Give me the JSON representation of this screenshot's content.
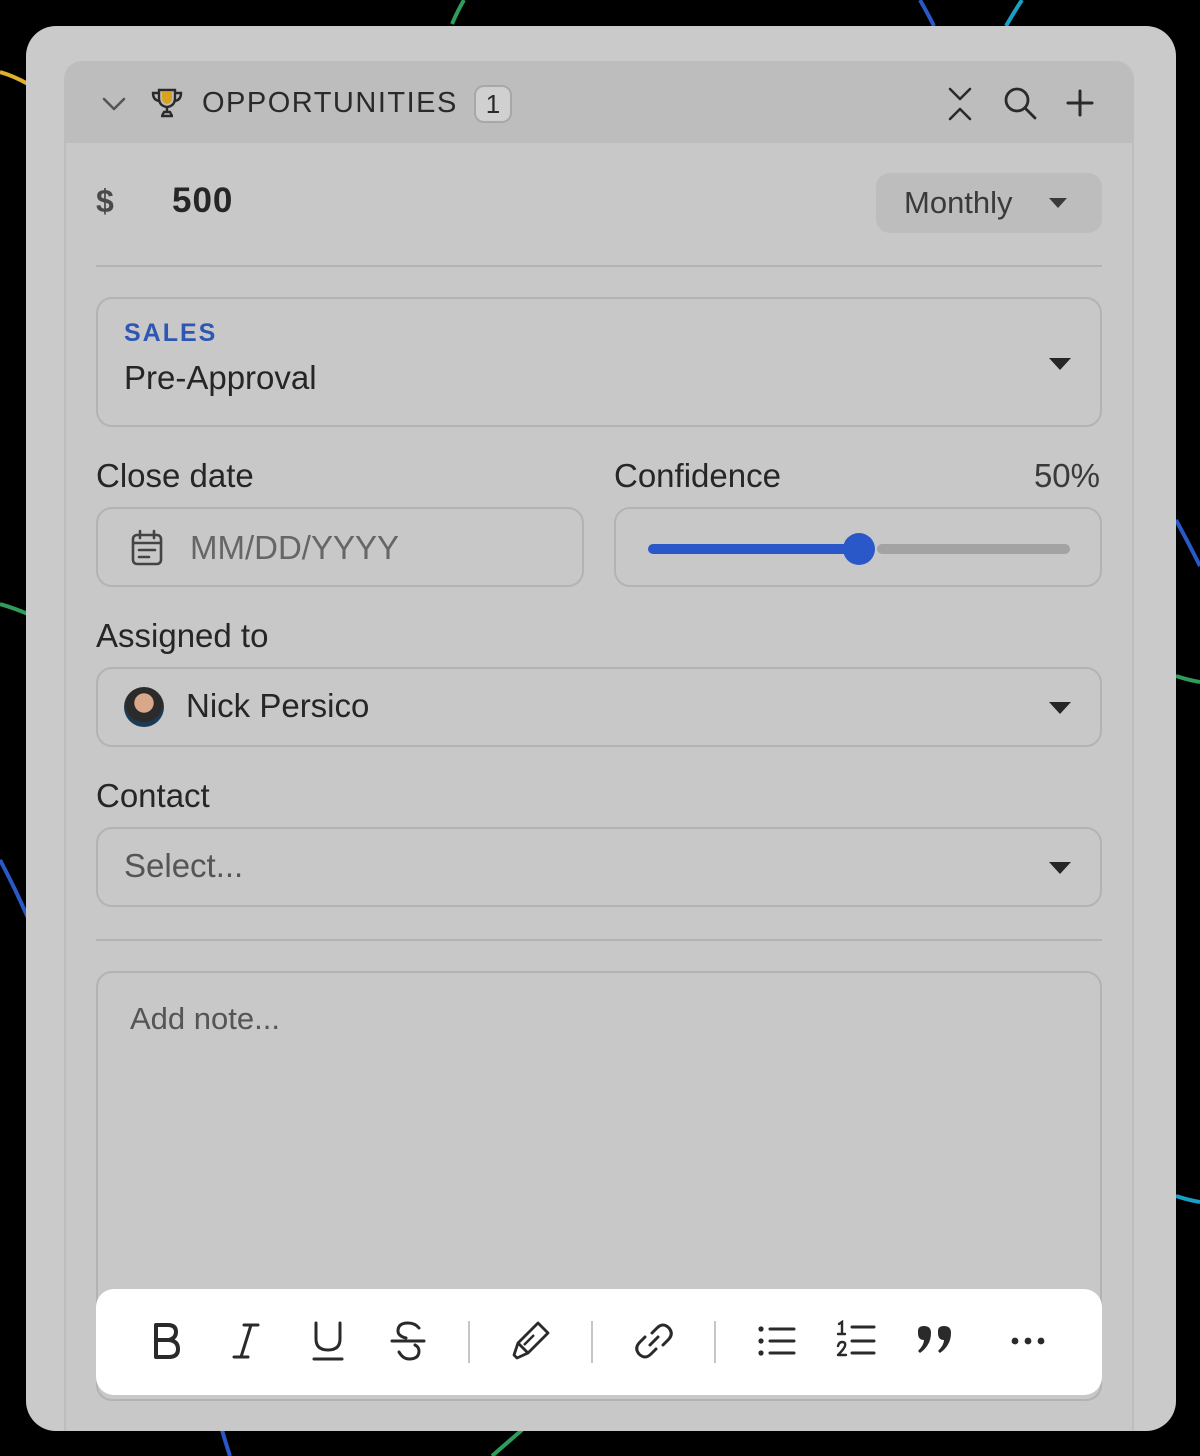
{
  "colors": {
    "accent": "#2b58c9",
    "stage_label": "#2e57b3",
    "panel_bg": "#cacaca",
    "header_bg": "#bdbdbd",
    "toolbar_bg": "#ffffff"
  },
  "header": {
    "title": "OPPORTUNITIES",
    "count": "1",
    "icons": [
      "chevron-down-icon",
      "trophy-icon",
      "collapse-icon",
      "search-icon",
      "plus-icon"
    ]
  },
  "amount": {
    "currency": "$",
    "value": "500",
    "period": "Monthly"
  },
  "stage": {
    "label": "SALES",
    "value": "Pre-Approval"
  },
  "close_date": {
    "label": "Close date",
    "placeholder": "MM/DD/YYYY"
  },
  "confidence": {
    "label": "Confidence",
    "value_text": "50%",
    "level": 0.5
  },
  "assigned": {
    "label": "Assigned to",
    "name": "Nick Persico"
  },
  "contact": {
    "label": "Contact",
    "placeholder": "Select..."
  },
  "note": {
    "placeholder": "Add note..."
  },
  "toolbar": {
    "tools": [
      "bold-icon",
      "italic-icon",
      "underline-icon",
      "strikethrough-icon",
      "highlighter-icon",
      "link-icon",
      "bullet-list-icon",
      "numbered-list-icon",
      "quote-icon",
      "more-icon"
    ]
  }
}
